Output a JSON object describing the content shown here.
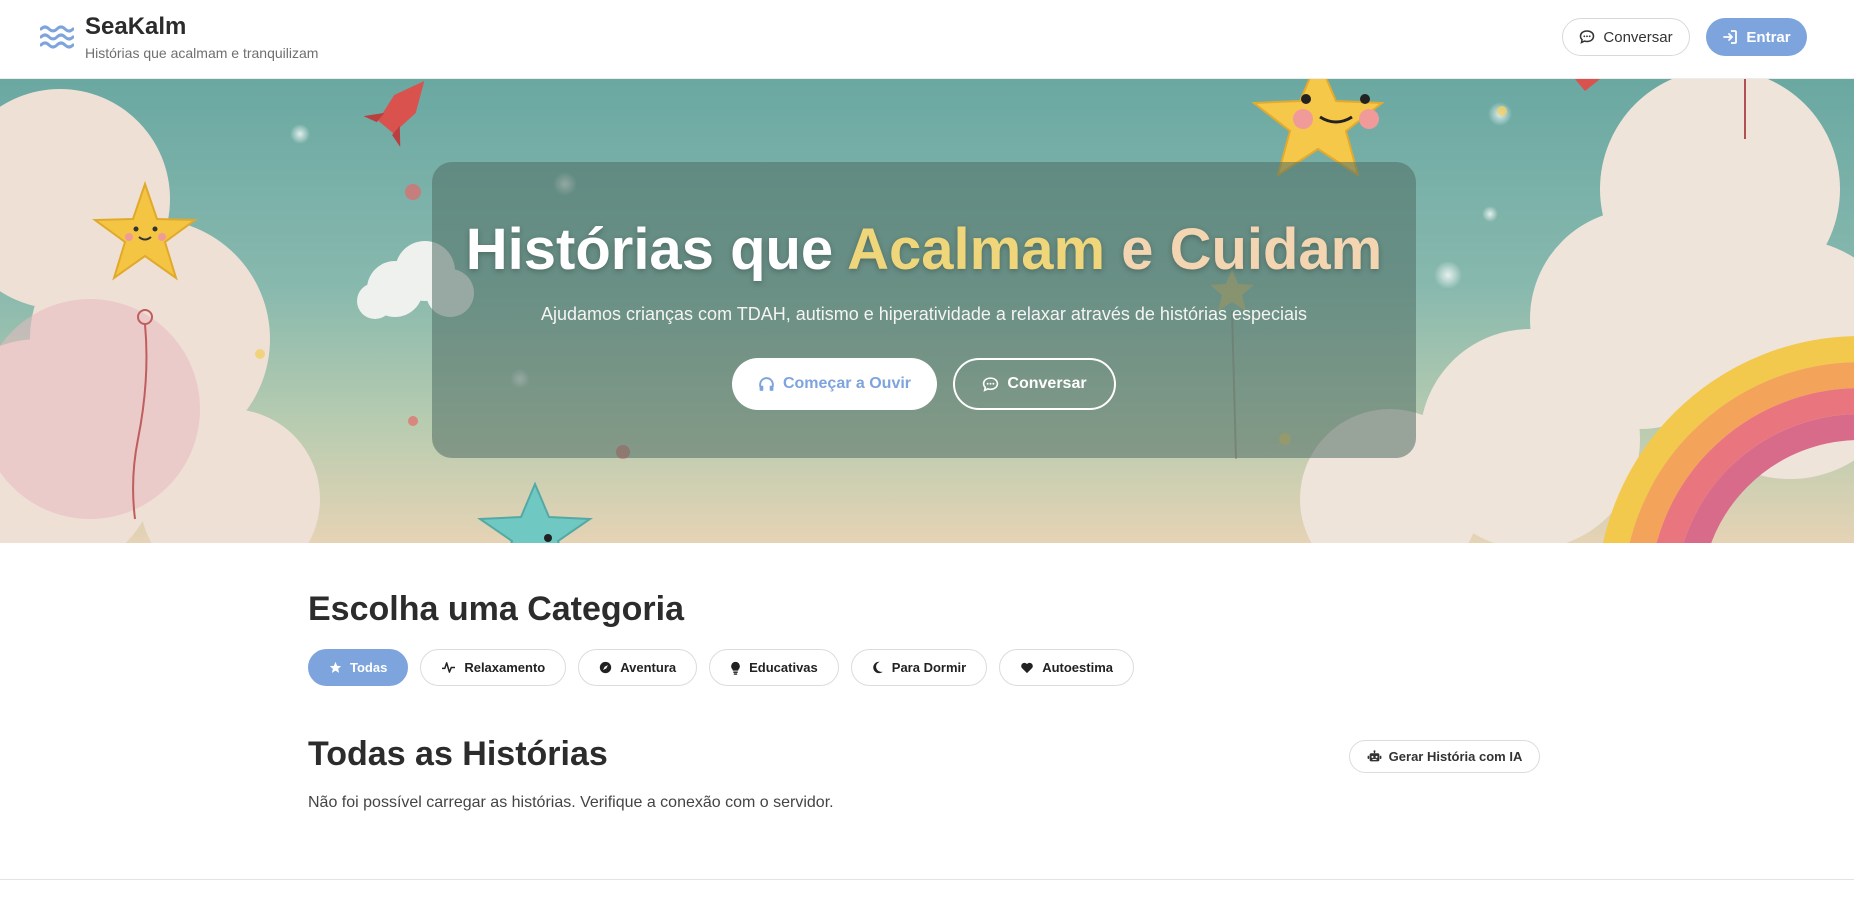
{
  "header": {
    "brand_title": "SeaKalm",
    "brand_subtitle": "Histórias que acalmam e tranquilizam",
    "chat_label": "Conversar",
    "login_label": "Entrar"
  },
  "hero": {
    "title_part1": "Histórias que ",
    "title_highlight1": "Acalmam",
    "title_part2": " e ",
    "title_highlight2": "Cuidam",
    "subtitle": "Ajudamos crianças com TDAH, autismo e hiperatividade a relaxar através de histórias especiais",
    "listen_label": "Começar a Ouvir",
    "chat_label": "Conversar"
  },
  "categories": {
    "title": "Escolha uma Categoria",
    "items": [
      {
        "label": "Todas",
        "icon": "star-icon",
        "active": true
      },
      {
        "label": "Relaxamento",
        "icon": "pulse-icon",
        "active": false
      },
      {
        "label": "Aventura",
        "icon": "compass-icon",
        "active": false
      },
      {
        "label": "Educativas",
        "icon": "lightbulb-icon",
        "active": false
      },
      {
        "label": "Para Dormir",
        "icon": "moon-icon",
        "active": false
      },
      {
        "label": "Autoestima",
        "icon": "heart-icon",
        "active": false
      }
    ]
  },
  "stories": {
    "title": "Todas as Histórias",
    "generate_label": "Gerar História com IA",
    "error_message": "Não foi possível carregar as histórias. Verifique a conexão com o servidor."
  },
  "colors": {
    "accent": "#7ea4dd",
    "highlight1": "#f0d67a",
    "highlight2": "#f3d5b2"
  }
}
